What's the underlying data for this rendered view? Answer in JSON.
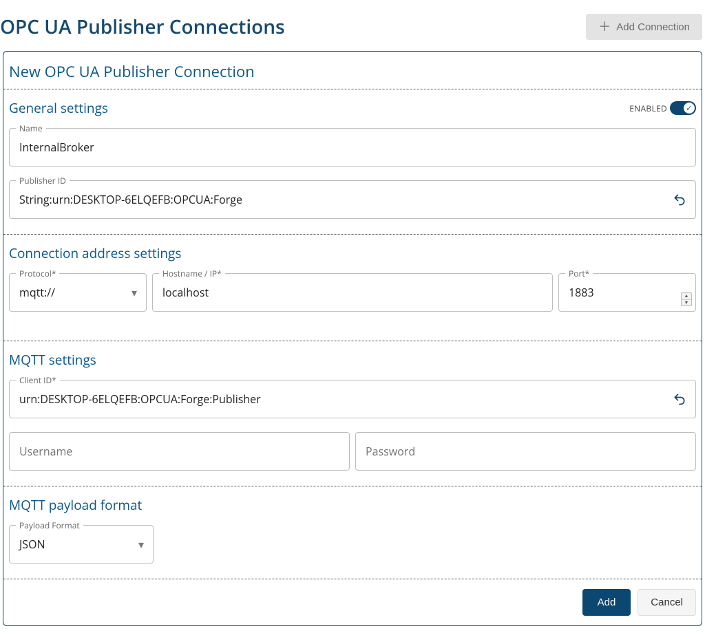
{
  "page": {
    "title": "OPC UA Publisher Connections",
    "add_connection": "Add Connection"
  },
  "panel": {
    "title": "New OPC UA Publisher Connection"
  },
  "general": {
    "section_title": "General settings",
    "enabled_label": "ENABLED",
    "name_label": "Name",
    "name_value": "InternalBroker",
    "publisher_id_label": "Publisher ID",
    "publisher_id_value": "String:urn:DESKTOP-6ELQEFB:OPCUA:Forge"
  },
  "conn": {
    "section_title": "Connection address settings",
    "protocol_label": "Protocol*",
    "protocol_value": "mqtt://",
    "hostname_label": "Hostname / IP*",
    "hostname_value": "localhost",
    "port_label": "Port*",
    "port_value": "1883"
  },
  "mqtt": {
    "section_title": "MQTT settings",
    "client_id_label": "Client ID*",
    "client_id_value": "urn:DESKTOP-6ELQEFB:OPCUA:Forge:Publisher",
    "username_placeholder": "Username",
    "password_placeholder": "Password"
  },
  "payload": {
    "section_title": "MQTT payload format",
    "format_label": "Payload Format",
    "format_value": "JSON"
  },
  "footer": {
    "add": "Add",
    "cancel": "Cancel"
  }
}
